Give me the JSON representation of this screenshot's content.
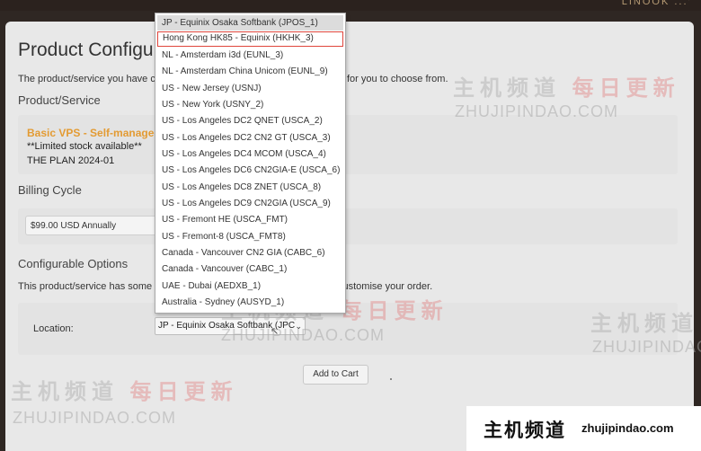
{
  "header": {
    "top_text": "LINOOK ...’"
  },
  "page": {
    "title": "Product Configur",
    "intro_left": "The product/service you have ch",
    "intro_right": "for you to choose from."
  },
  "product": {
    "section_title": "Product/Service",
    "name": "Basic VPS - Self-managed -",
    "stock": "**Limited stock available**",
    "plan": "THE PLAN 2024-01"
  },
  "billing": {
    "section_title": "Billing Cycle",
    "selected": "$99.00 USD Annually"
  },
  "configurable": {
    "section_title": "Configurable Options",
    "text_left": "This product/service has some c",
    "text_right": "customise your order.",
    "location_label": "Location:",
    "location_selected": "JP - Equinix Osaka Softbank (JPC"
  },
  "dropdown": {
    "options": [
      "JP - Equinix Osaka Softbank (JPOS_1)",
      "Hong Kong HK85 - Equinix (HKHK_3)",
      "NL - Amsterdam i3d (EUNL_3)",
      "NL - Amsterdam China Unicom (EUNL_9)",
      "US - New Jersey (USNJ)",
      "US - New York (USNY_2)",
      "US - Los Angeles DC2 QNET (USCA_2)",
      "US - Los Angeles DC2 CN2 GT (USCA_3)",
      "US - Los Angeles DC4 MCOM (USCA_4)",
      "US - Los Angeles DC6 CN2GIA-E (USCA_6)",
      "US - Los Angeles DC8 ZNET (USCA_8)",
      "US - Los Angeles DC9 CN2GIA (USCA_9)",
      "US - Fremont HE (USCA_FMT)",
      "US - Fremont-8 (USCA_FMT8)",
      "Canada - Vancouver CN2 GIA (CABC_6)",
      "Canada - Vancouver (CABC_1)",
      "UAE - Dubai (AEDXB_1)",
      "Australia - Sydney (AUSYD_1)"
    ],
    "selected_index": 0,
    "highlighted_index": 1
  },
  "actions": {
    "add_to_cart": "Add to Cart"
  },
  "watermark": {
    "cn_gray": "主机频道",
    "cn_red": "每日更新",
    "en": "ZHUJIPINDAO.COM"
  },
  "logo": {
    "cn": "主机频道",
    "en": "zhujipindao.com"
  },
  "colors": {
    "product_name": "#e39b33",
    "highlight_border": "#e0453c",
    "page_bg": "#e8e8e8",
    "frame_bg": "#2f2723"
  }
}
